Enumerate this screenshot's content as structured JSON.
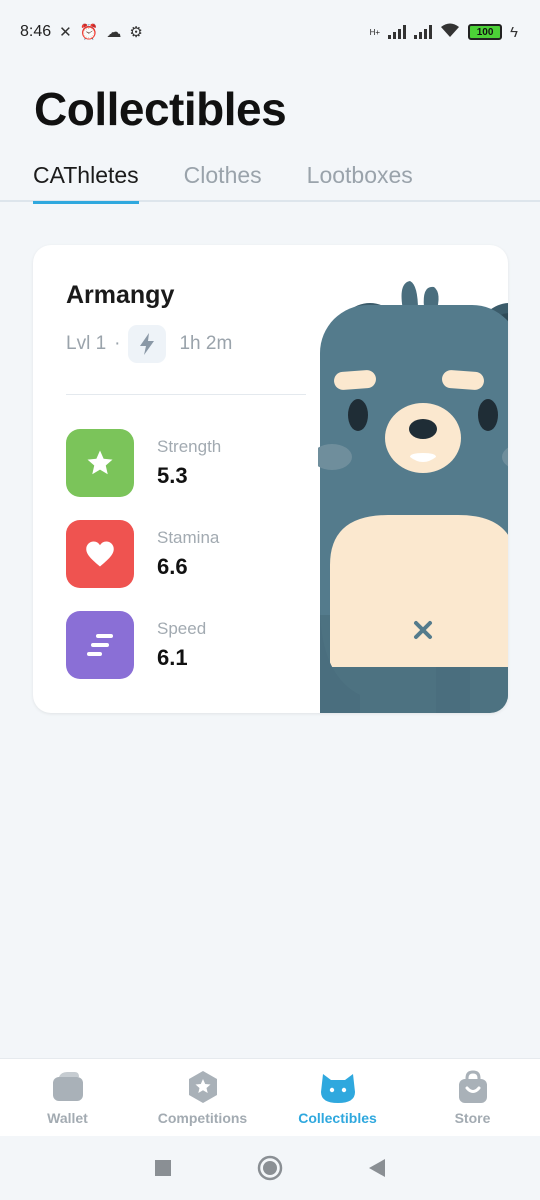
{
  "status_bar": {
    "time": "8:46",
    "battery": "100",
    "network": "H+"
  },
  "header": {
    "title": "Collectibles"
  },
  "tabs": [
    {
      "label": "CAThletes",
      "active": true
    },
    {
      "label": "Clothes",
      "active": false
    },
    {
      "label": "Lootboxes",
      "active": false
    }
  ],
  "card": {
    "name": "Armangy",
    "level": "Lvl 1",
    "separator": "·",
    "time": "1h 2m",
    "stats": [
      {
        "label": "Strength",
        "value": "5.3",
        "icon": "star-icon",
        "color": "#7bc45a"
      },
      {
        "label": "Stamina",
        "value": "6.6",
        "icon": "heart-icon",
        "color": "#ef5350"
      },
      {
        "label": "Speed",
        "value": "6.1",
        "icon": "speed-lines-icon",
        "color": "#8a6fd6"
      }
    ]
  },
  "bottom_nav": [
    {
      "label": "Wallet",
      "icon": "wallet-icon",
      "active": false
    },
    {
      "label": "Competitions",
      "icon": "competitions-icon",
      "active": false
    },
    {
      "label": "Collectibles",
      "icon": "cat-icon",
      "active": true
    },
    {
      "label": "Store",
      "icon": "shopping-bag-icon",
      "active": false
    }
  ],
  "colors": {
    "accent": "#2fa8de",
    "background": "#f3f6f9",
    "bear": "#547b8c",
    "bear_belly": "#fbe8cf"
  }
}
